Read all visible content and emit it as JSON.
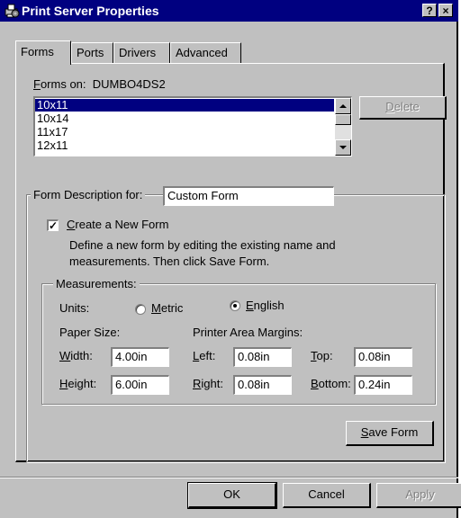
{
  "window": {
    "title": "Print Server Properties",
    "help_label": "?",
    "close_label": "×"
  },
  "tabs": [
    {
      "label": "Forms",
      "active": true
    },
    {
      "label": "Ports",
      "active": false
    },
    {
      "label": "Drivers",
      "active": false
    },
    {
      "label": "Advanced",
      "active": false
    }
  ],
  "forms": {
    "label_accel": "F",
    "label_rest": "orms on:",
    "server": "DUMBO4DS2",
    "list": [
      "10x11",
      "10x14",
      "11x17",
      "12x11"
    ],
    "selected_index": 0,
    "delete_accel": "D",
    "delete_rest": "elete"
  },
  "form_description": {
    "label": "Form Description for:",
    "value": "Custom Form",
    "create_accel": "C",
    "create_rest": "reate a New Form",
    "create_checked": true,
    "help_line1": "Define a new form by editing the existing name and",
    "help_line2": "measurements.  Then click Save Form."
  },
  "measurements": {
    "label": "Measurements:",
    "units_label": "Units:",
    "metric_accel": "M",
    "metric_rest": "etric",
    "english_accel": "E",
    "english_rest": "nglish",
    "selected_unit": "English",
    "paper_size_label": "Paper Size:",
    "margins_label": "Printer Area Margins:",
    "width_accel": "W",
    "width_rest": "idth:",
    "width_value": "4.00in",
    "height_accel": "H",
    "height_rest": "eight:",
    "height_value": "6.00in",
    "left_accel": "L",
    "left_rest": "eft:",
    "left_value": "0.08in",
    "right_accel": "R",
    "right_rest": "ight:",
    "right_value": "0.08in",
    "top_accel": "T",
    "top_rest": "op:",
    "top_value": "0.08in",
    "bottom_accel": "B",
    "bottom_rest": "ottom:",
    "bottom_value": "0.24in",
    "save_accel": "S",
    "save_rest": "ave Form"
  },
  "footer": {
    "ok_label": "OK",
    "cancel_label": "Cancel",
    "apply_label": "Apply"
  },
  "colors": {
    "titlebar": "#000080",
    "face": "#c0c0c0",
    "selection": "#000080"
  }
}
